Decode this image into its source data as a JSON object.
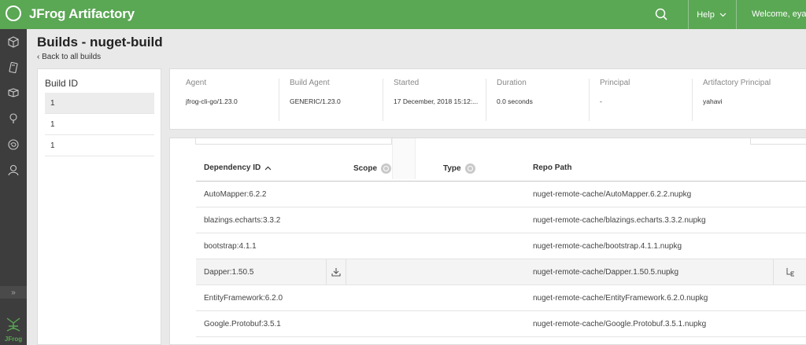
{
  "app": {
    "title": "JFrog Artifactory"
  },
  "topbar": {
    "help_label": "Help",
    "welcome": "Welcome, eyalb"
  },
  "nav": {
    "items": [
      "home-icon",
      "artifacts-icon",
      "builds-icon",
      "bulb-icon",
      "jfrog-swirl-icon",
      "admin-user-icon"
    ],
    "expand_label": "»",
    "footer_text": "JFrog"
  },
  "page": {
    "title": "Builds - nuget-build",
    "back_label": "Back to all builds"
  },
  "builds": {
    "title": "Build ID",
    "rows": [
      "1",
      "1",
      "1"
    ]
  },
  "info": [
    {
      "label": "Agent",
      "value": "jfrog-cli-go/1.23.0"
    },
    {
      "label": "Build Agent",
      "value": "GENERIC/1.23.0"
    },
    {
      "label": "Started",
      "value": "17 December, 2018 15:12:..."
    },
    {
      "label": "Duration",
      "value": "0.0 seconds"
    },
    {
      "label": "Principal",
      "value": "-"
    },
    {
      "label": "Artifactory Principal",
      "value": "yahavi"
    }
  ],
  "dependencies": {
    "columns": {
      "id": "Dependency ID",
      "scope": "Scope",
      "type": "Type",
      "repo": "Repo Path"
    },
    "rows": [
      {
        "id": "AutoMapper:6.2.2",
        "repo": "nuget-remote-cache/AutoMapper.6.2.2.nupkg"
      },
      {
        "id": "blazings.echarts:3.3.2",
        "repo": "nuget-remote-cache/blazings.echarts.3.3.2.nupkg"
      },
      {
        "id": "bootstrap:4.1.1",
        "repo": "nuget-remote-cache/bootstrap.4.1.1.nupkg"
      },
      {
        "id": "Dapper:1.50.5",
        "repo": "nuget-remote-cache/Dapper.1.50.5.nupkg"
      },
      {
        "id": "EntityFramework:6.2.0",
        "repo": "nuget-remote-cache/EntityFramework.6.2.0.nupkg"
      },
      {
        "id": "Google.Protobuf:3.5.1",
        "repo": "nuget-remote-cache/Google.Protobuf.3.5.1.nupkg"
      }
    ]
  },
  "colors": {
    "brand": "#5aa754",
    "nav": "#3d3d3d"
  }
}
